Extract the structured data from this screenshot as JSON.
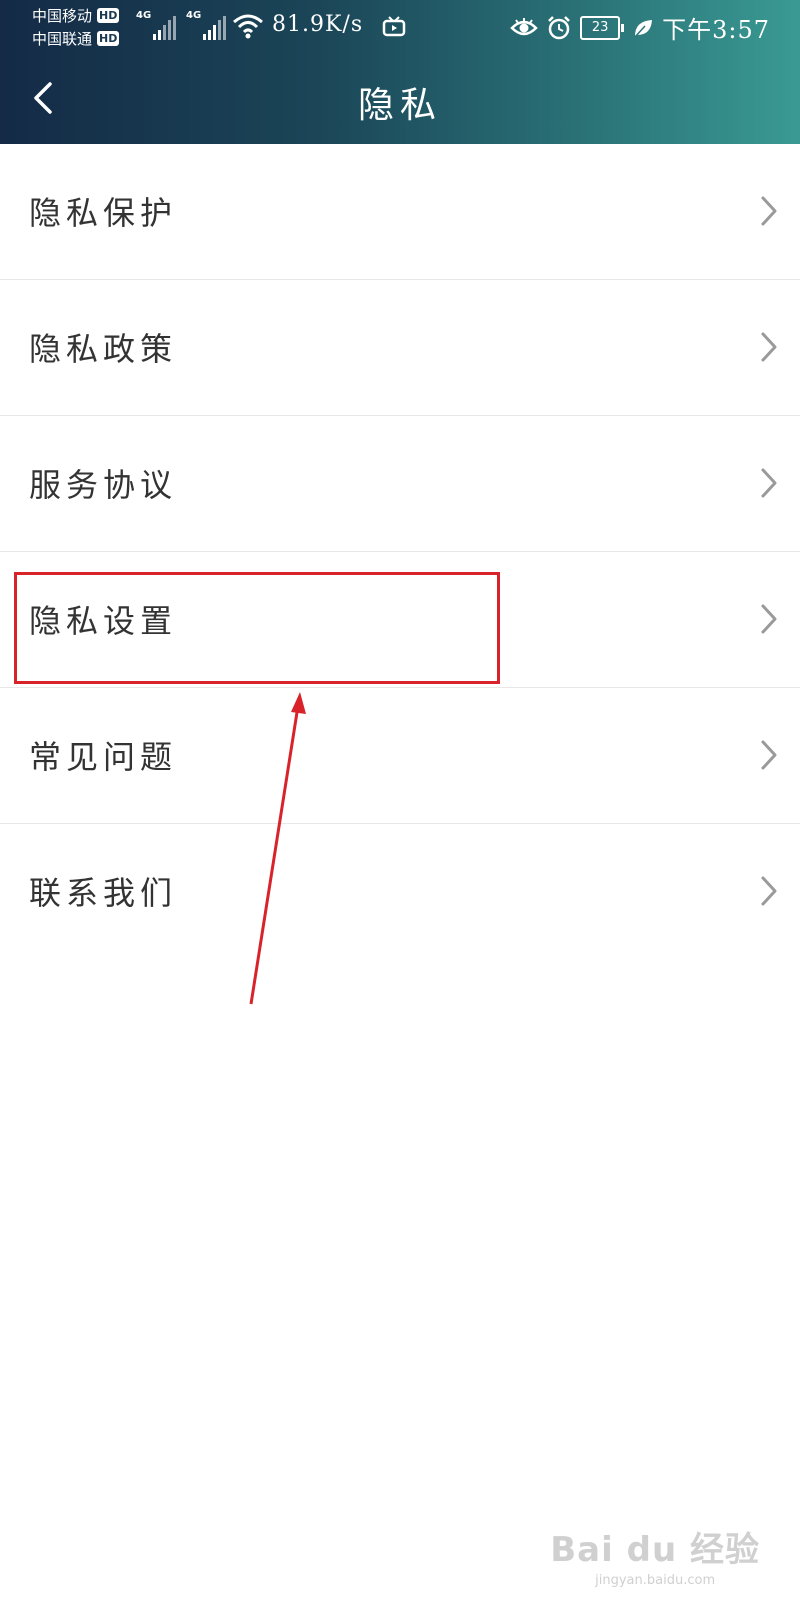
{
  "status_bar": {
    "carrier_1": "中国移动",
    "carrier_2": "中国联通",
    "hd_badge": "HD",
    "network_type": "4G",
    "net_speed": "81.9K/s",
    "battery_level": "23",
    "time": "下午3:57"
  },
  "header": {
    "title": "隐私",
    "back_icon": "chevron-left-icon"
  },
  "menu": {
    "items": [
      {
        "label": "隐私保护"
      },
      {
        "label": "隐私政策"
      },
      {
        "label": "服务协议"
      },
      {
        "label": "隐私设置"
      },
      {
        "label": "常见问题"
      },
      {
        "label": "联系我们"
      }
    ],
    "chevron_icon": "chevron-right-icon"
  },
  "annotation": {
    "highlight_color": "#d8232a",
    "highlighted_item": "隐私设置"
  },
  "watermark": {
    "logo": "Bai du 经验",
    "url": "jingyan.baidu.com"
  },
  "colors": {
    "header_gradient_start": "#142a46",
    "header_gradient_end": "#3a9a93",
    "divider": "#e8e8e8",
    "text": "#333333",
    "chevron": "#9a9a9a"
  }
}
